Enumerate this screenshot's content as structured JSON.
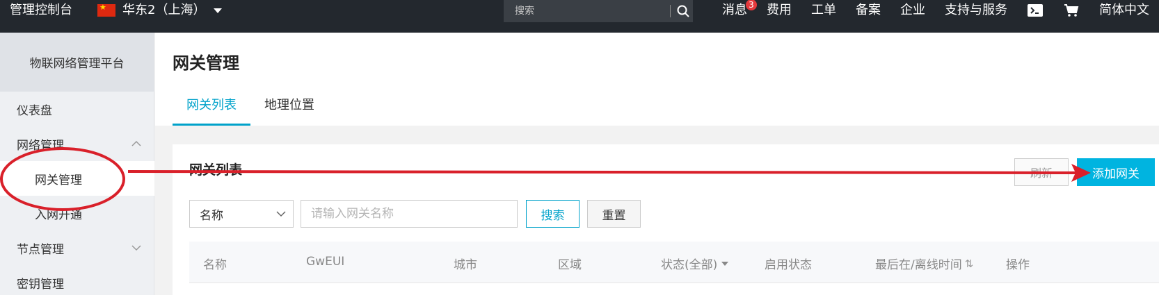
{
  "topbar": {
    "brand": "管理控制台",
    "region": "华东2（上海）",
    "search_placeholder": "搜索",
    "nav": [
      {
        "label": "消息",
        "badge": "3"
      },
      {
        "label": "费用"
      },
      {
        "label": "工单"
      },
      {
        "label": "备案"
      },
      {
        "label": "企业"
      },
      {
        "label": "支持与服务"
      }
    ],
    "icons": [
      "terminal-icon",
      "cart-icon"
    ],
    "language": "简体中文"
  },
  "sidebar": {
    "platform": "物联网络管理平台",
    "items": [
      {
        "label": "仪表盘"
      },
      {
        "label": "网络管理",
        "expanded": true
      },
      {
        "label": "网关管理",
        "sub": true,
        "active": true
      },
      {
        "label": "入网开通",
        "sub": true
      },
      {
        "label": "节点管理",
        "expanded": false
      },
      {
        "label": "密钥管理"
      }
    ]
  },
  "main": {
    "title": "网关管理",
    "tabs": [
      {
        "label": "网关列表",
        "active": true
      },
      {
        "label": "地理位置"
      }
    ],
    "panel": {
      "title": "网关列表",
      "refresh_label": "刷新",
      "add_label": "添加网关",
      "filter_field": "名称",
      "filter_placeholder": "请输入网关名称",
      "search_label": "搜索",
      "reset_label": "重置",
      "columns": [
        "名称",
        "GwEUI",
        "城市",
        "区域",
        "状态(全部)",
        "启用状态",
        "最后在/离线时间",
        "操作"
      ]
    }
  },
  "colors": {
    "topbar_bg": "#23282e",
    "accent": "#00a2ca",
    "primary_button": "#00b4e0",
    "annotation": "#d9202a"
  }
}
